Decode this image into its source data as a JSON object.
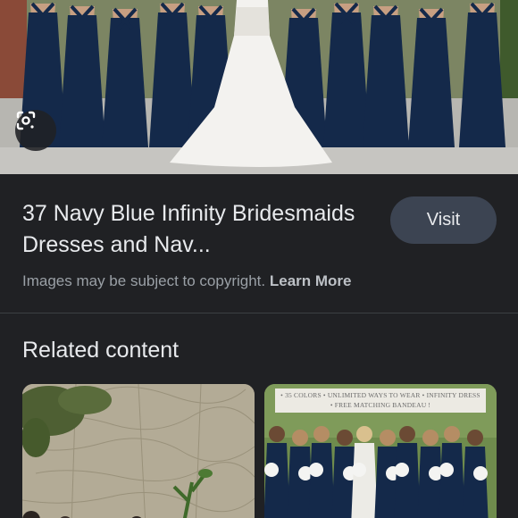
{
  "hero": {
    "image_alt": "Bridesmaids in navy blue infinity dresses standing with bride in white gown, backs turned"
  },
  "result": {
    "title": "37 Navy Blue Infinity Bridesmaids Dresses and Nav...",
    "visit_label": "Visit",
    "copyright_text": "Images may be subject to copyright.",
    "learn_more_label": "Learn More"
  },
  "related": {
    "heading": "Related content",
    "items": [
      {
        "image_alt": "Outdoor wedding party in front of stone wall"
      },
      {
        "banner_line1": "• 35 COLORS • UNLIMITED WAYS TO WEAR • INFINITY DRESS",
        "banner_line2": "• FREE MATCHING BANDEAU !",
        "image_alt": "Bride with bridesmaids in navy infinity dresses holding white bouquets"
      }
    ]
  },
  "colors": {
    "background": "#202124",
    "visit_button": "#3c4452",
    "navy_dress": "#14294a",
    "text_primary": "#e8eaed",
    "text_secondary": "#9aa0a6"
  },
  "icons": {
    "lens": "google-lens-icon"
  }
}
